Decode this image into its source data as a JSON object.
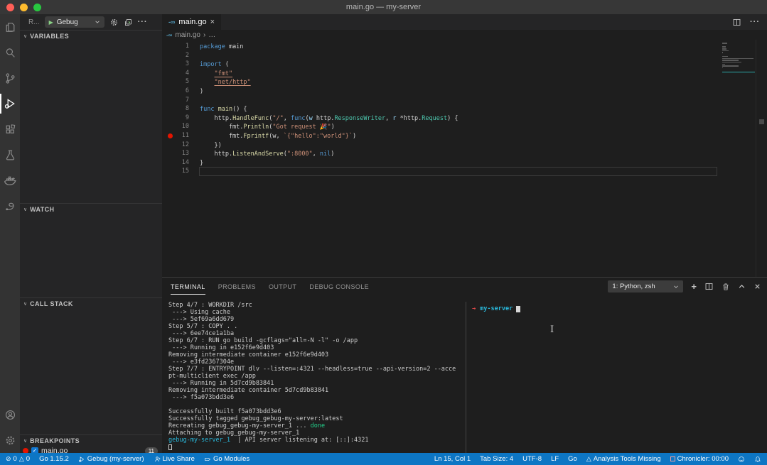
{
  "window": {
    "title": "main.go — my-server"
  },
  "colors": {
    "statusbar": "#0d76c4",
    "keyword": "#569cd6",
    "string": "#ce9178",
    "function": "#dcdcaa",
    "type": "#4ec9b0",
    "breakpoint": "#e51400",
    "terminal_green": "#23d18b",
    "terminal_cyan": "#29b8db",
    "prompt_red": "#f14c4c",
    "go_icon": "#519aba"
  },
  "icons": {
    "go_file": "-∞",
    "close": "×",
    "chevron_down": "∨",
    "chevron_up": "∧",
    "more": "···",
    "play": "▶",
    "plus": "+",
    "check": "✓",
    "error": "⊘",
    "warning": "△",
    "breadcrumb_sep": "›",
    "breadcrumb_more": "…",
    "ibeam": "I"
  },
  "activity_bar": {
    "items": [
      "explorer",
      "search",
      "source-control",
      "run-and-debug",
      "extensions",
      "test",
      "docker",
      "gebug"
    ],
    "bottom_items": [
      "accounts",
      "settings"
    ],
    "active": "run-and-debug"
  },
  "sidebar": {
    "toolbar": {
      "run_label": "R...",
      "config_label": "Gebug"
    },
    "sections": {
      "variables": "VARIABLES",
      "watch": "WATCH",
      "call_stack": "CALL STACK",
      "breakpoints": "BREAKPOINTS"
    },
    "breakpoints": {
      "file": "main.go",
      "badge": "11"
    }
  },
  "editor": {
    "tab": {
      "label": "main.go"
    },
    "breadcrumb": {
      "file": "main.go"
    },
    "code_lines": [
      {
        "n": "1",
        "t": [
          [
            "kw",
            "package"
          ],
          [
            "txt",
            " main"
          ]
        ]
      },
      {
        "n": "2",
        "t": []
      },
      {
        "n": "3",
        "t": [
          [
            "kw",
            "import"
          ],
          [
            "txt",
            " ("
          ]
        ]
      },
      {
        "n": "4",
        "t": [
          [
            "txt",
            "    "
          ],
          [
            "stru",
            "\"fmt\""
          ]
        ]
      },
      {
        "n": "5",
        "t": [
          [
            "txt",
            "    "
          ],
          [
            "stru",
            "\"net/http\""
          ]
        ]
      },
      {
        "n": "6",
        "t": [
          [
            "txt",
            ")"
          ]
        ]
      },
      {
        "n": "7",
        "t": []
      },
      {
        "n": "8",
        "t": [
          [
            "kw",
            "func"
          ],
          [
            "fn",
            " main"
          ],
          [
            "txt",
            "() {"
          ]
        ]
      },
      {
        "n": "9",
        "t": [
          [
            "txt",
            "    http."
          ],
          [
            "fn",
            "HandleFunc"
          ],
          [
            "txt",
            "("
          ],
          [
            "str",
            "\"/\""
          ],
          [
            "txt",
            ", "
          ],
          [
            "kw",
            "func"
          ],
          [
            "txt",
            "("
          ],
          [
            "param",
            "w"
          ],
          [
            "txt",
            " http."
          ],
          [
            "type",
            "ResponseWriter"
          ],
          [
            "txt",
            ", "
          ],
          [
            "param",
            "r"
          ],
          [
            "txt",
            " *http."
          ],
          [
            "type",
            "Request"
          ],
          [
            "txt",
            ") {"
          ]
        ]
      },
      {
        "n": "10",
        "t": [
          [
            "txt",
            "        fmt."
          ],
          [
            "fn",
            "Println"
          ],
          [
            "txt",
            "("
          ],
          [
            "str",
            "\"Got request 🎉\""
          ],
          [
            "txt",
            ")"
          ]
        ]
      },
      {
        "n": "11",
        "bp": true,
        "t": [
          [
            "txt",
            "        fmt."
          ],
          [
            "fn",
            "Fprintf"
          ],
          [
            "txt",
            "(w, "
          ],
          [
            "str",
            "`{\"hello\":\"world\"}`"
          ],
          [
            "txt",
            ")"
          ]
        ]
      },
      {
        "n": "12",
        "t": [
          [
            "txt",
            "    })"
          ]
        ]
      },
      {
        "n": "13",
        "t": [
          [
            "txt",
            "    http."
          ],
          [
            "fn",
            "ListenAndServe"
          ],
          [
            "txt",
            "("
          ],
          [
            "str",
            "\":8000\""
          ],
          [
            "txt",
            ", "
          ],
          [
            "kw",
            "nil"
          ],
          [
            "txt",
            ")"
          ]
        ]
      },
      {
        "n": "14",
        "t": [
          [
            "txt",
            "}"
          ]
        ]
      },
      {
        "n": "15",
        "cur": true,
        "t": []
      }
    ]
  },
  "panel": {
    "tabs": [
      "TERMINAL",
      "PROBLEMS",
      "OUTPUT",
      "DEBUG CONSOLE"
    ],
    "active_tab": "TERMINAL",
    "terminal_select": "1: Python, zsh",
    "left_terminal_lines": [
      [
        [
          "d",
          "Step 4/7 : WORKDIR /src"
        ]
      ],
      [
        [
          "d",
          " ---> Using cache"
        ]
      ],
      [
        [
          "d",
          " ---> 5ef69a6dd679"
        ]
      ],
      [
        [
          "d",
          "Step 5/7 : COPY . ."
        ]
      ],
      [
        [
          "d",
          " ---> 6ee74ce1a1ba"
        ]
      ],
      [
        [
          "d",
          "Step 6/7 : RUN go build -gcflags=\"all=-N -l\" -o /app"
        ]
      ],
      [
        [
          "d",
          " ---> Running in e152f6e9d403"
        ]
      ],
      [
        [
          "d",
          "Removing intermediate container e152f6e9d403"
        ]
      ],
      [
        [
          "d",
          " ---> e3fd2367304e"
        ]
      ],
      [
        [
          "d",
          "Step 7/7 : ENTRYPOINT dlv --listen=:4321 --headless=true --api-version=2 --acce"
        ]
      ],
      [
        [
          "d",
          "pt-multiclient exec /app"
        ]
      ],
      [
        [
          "d",
          " ---> Running in 5d7cd9b83841"
        ]
      ],
      [
        [
          "d",
          "Removing intermediate container 5d7cd9b83841"
        ]
      ],
      [
        [
          "d",
          " ---> f5a073bdd3e6"
        ]
      ],
      [
        [
          "d",
          ""
        ]
      ],
      [
        [
          "d",
          "Successfully built f5a073bdd3e6"
        ]
      ],
      [
        [
          "d",
          "Successfully tagged gebug_gebug-my-server:latest"
        ]
      ],
      [
        [
          "d",
          "Recreating gebug_gebug-my-server_1 ... "
        ],
        [
          "g",
          "done"
        ]
      ],
      [
        [
          "d",
          "Attaching to gebug_gebug-my-server_1"
        ]
      ],
      [
        [
          "c",
          "gebug-my-server_1"
        ],
        [
          "d",
          "  | API server listening at: [::]:4321"
        ]
      ],
      [
        [
          "cursor",
          ""
        ]
      ]
    ],
    "right_terminal": {
      "arrow": "→",
      "name": "my-server"
    }
  },
  "statusbar": {
    "errors": "0",
    "warnings": "0",
    "go_version": "Go 1.15.2",
    "debug_target": "Gebug (my-server)",
    "live_share": "Live Share",
    "go_modules": "Go Modules",
    "cursor_position": "Ln 15, Col 1",
    "tab_size": "Tab Size: 4",
    "encoding": "UTF-8",
    "eol": "LF",
    "language": "Go",
    "analysis": "Analysis Tools Missing",
    "chronicler": "Chronicler: 00:00"
  }
}
